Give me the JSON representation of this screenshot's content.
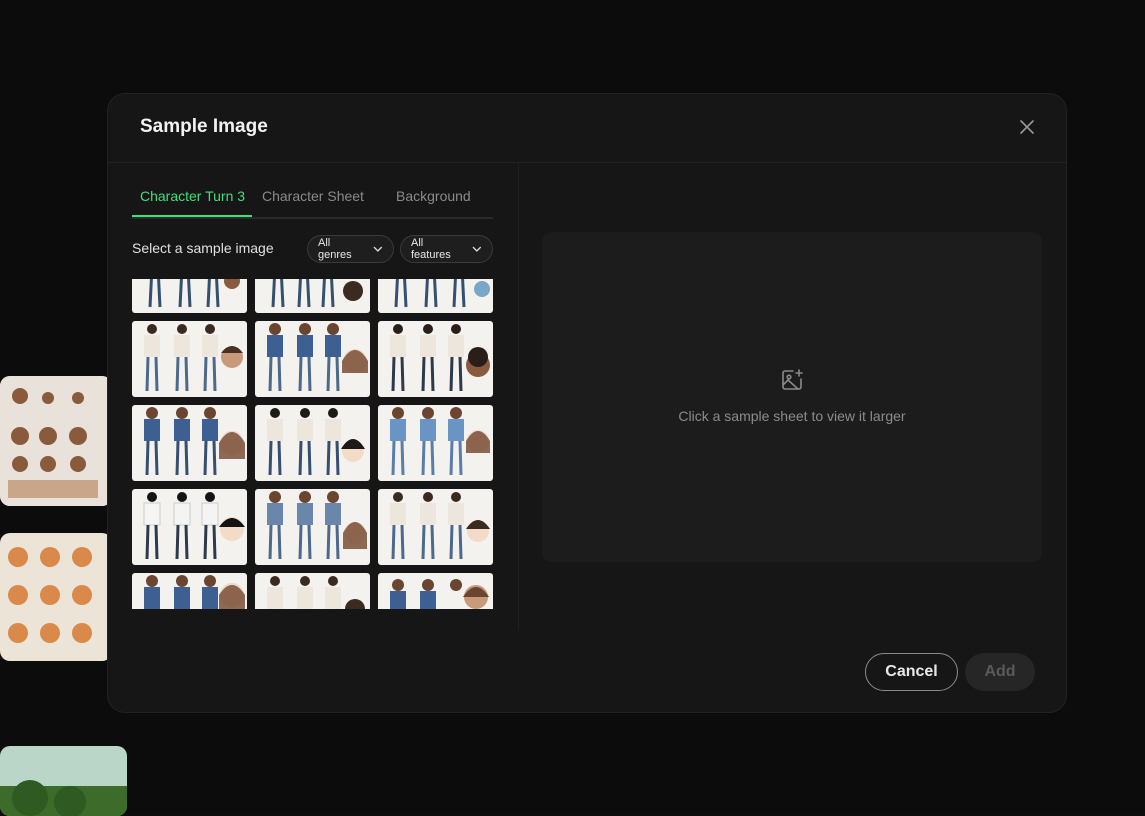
{
  "modal": {
    "title": "Sample Image"
  },
  "tabs": [
    {
      "label": "Character Turn 3",
      "active": true
    },
    {
      "label": "Character Sheet",
      "active": false
    },
    {
      "label": "Background",
      "active": false
    }
  ],
  "filters": {
    "prompt": "Select a sample image",
    "genre": "All genres",
    "feature": "All features"
  },
  "preview": {
    "hint": "Click a sample sheet to view it larger",
    "icon": "image-plus-icon"
  },
  "buttons": {
    "cancel": "Cancel",
    "add": "Add"
  },
  "colors": {
    "accent": "#3ee07a",
    "modal_bg": "#161616"
  }
}
